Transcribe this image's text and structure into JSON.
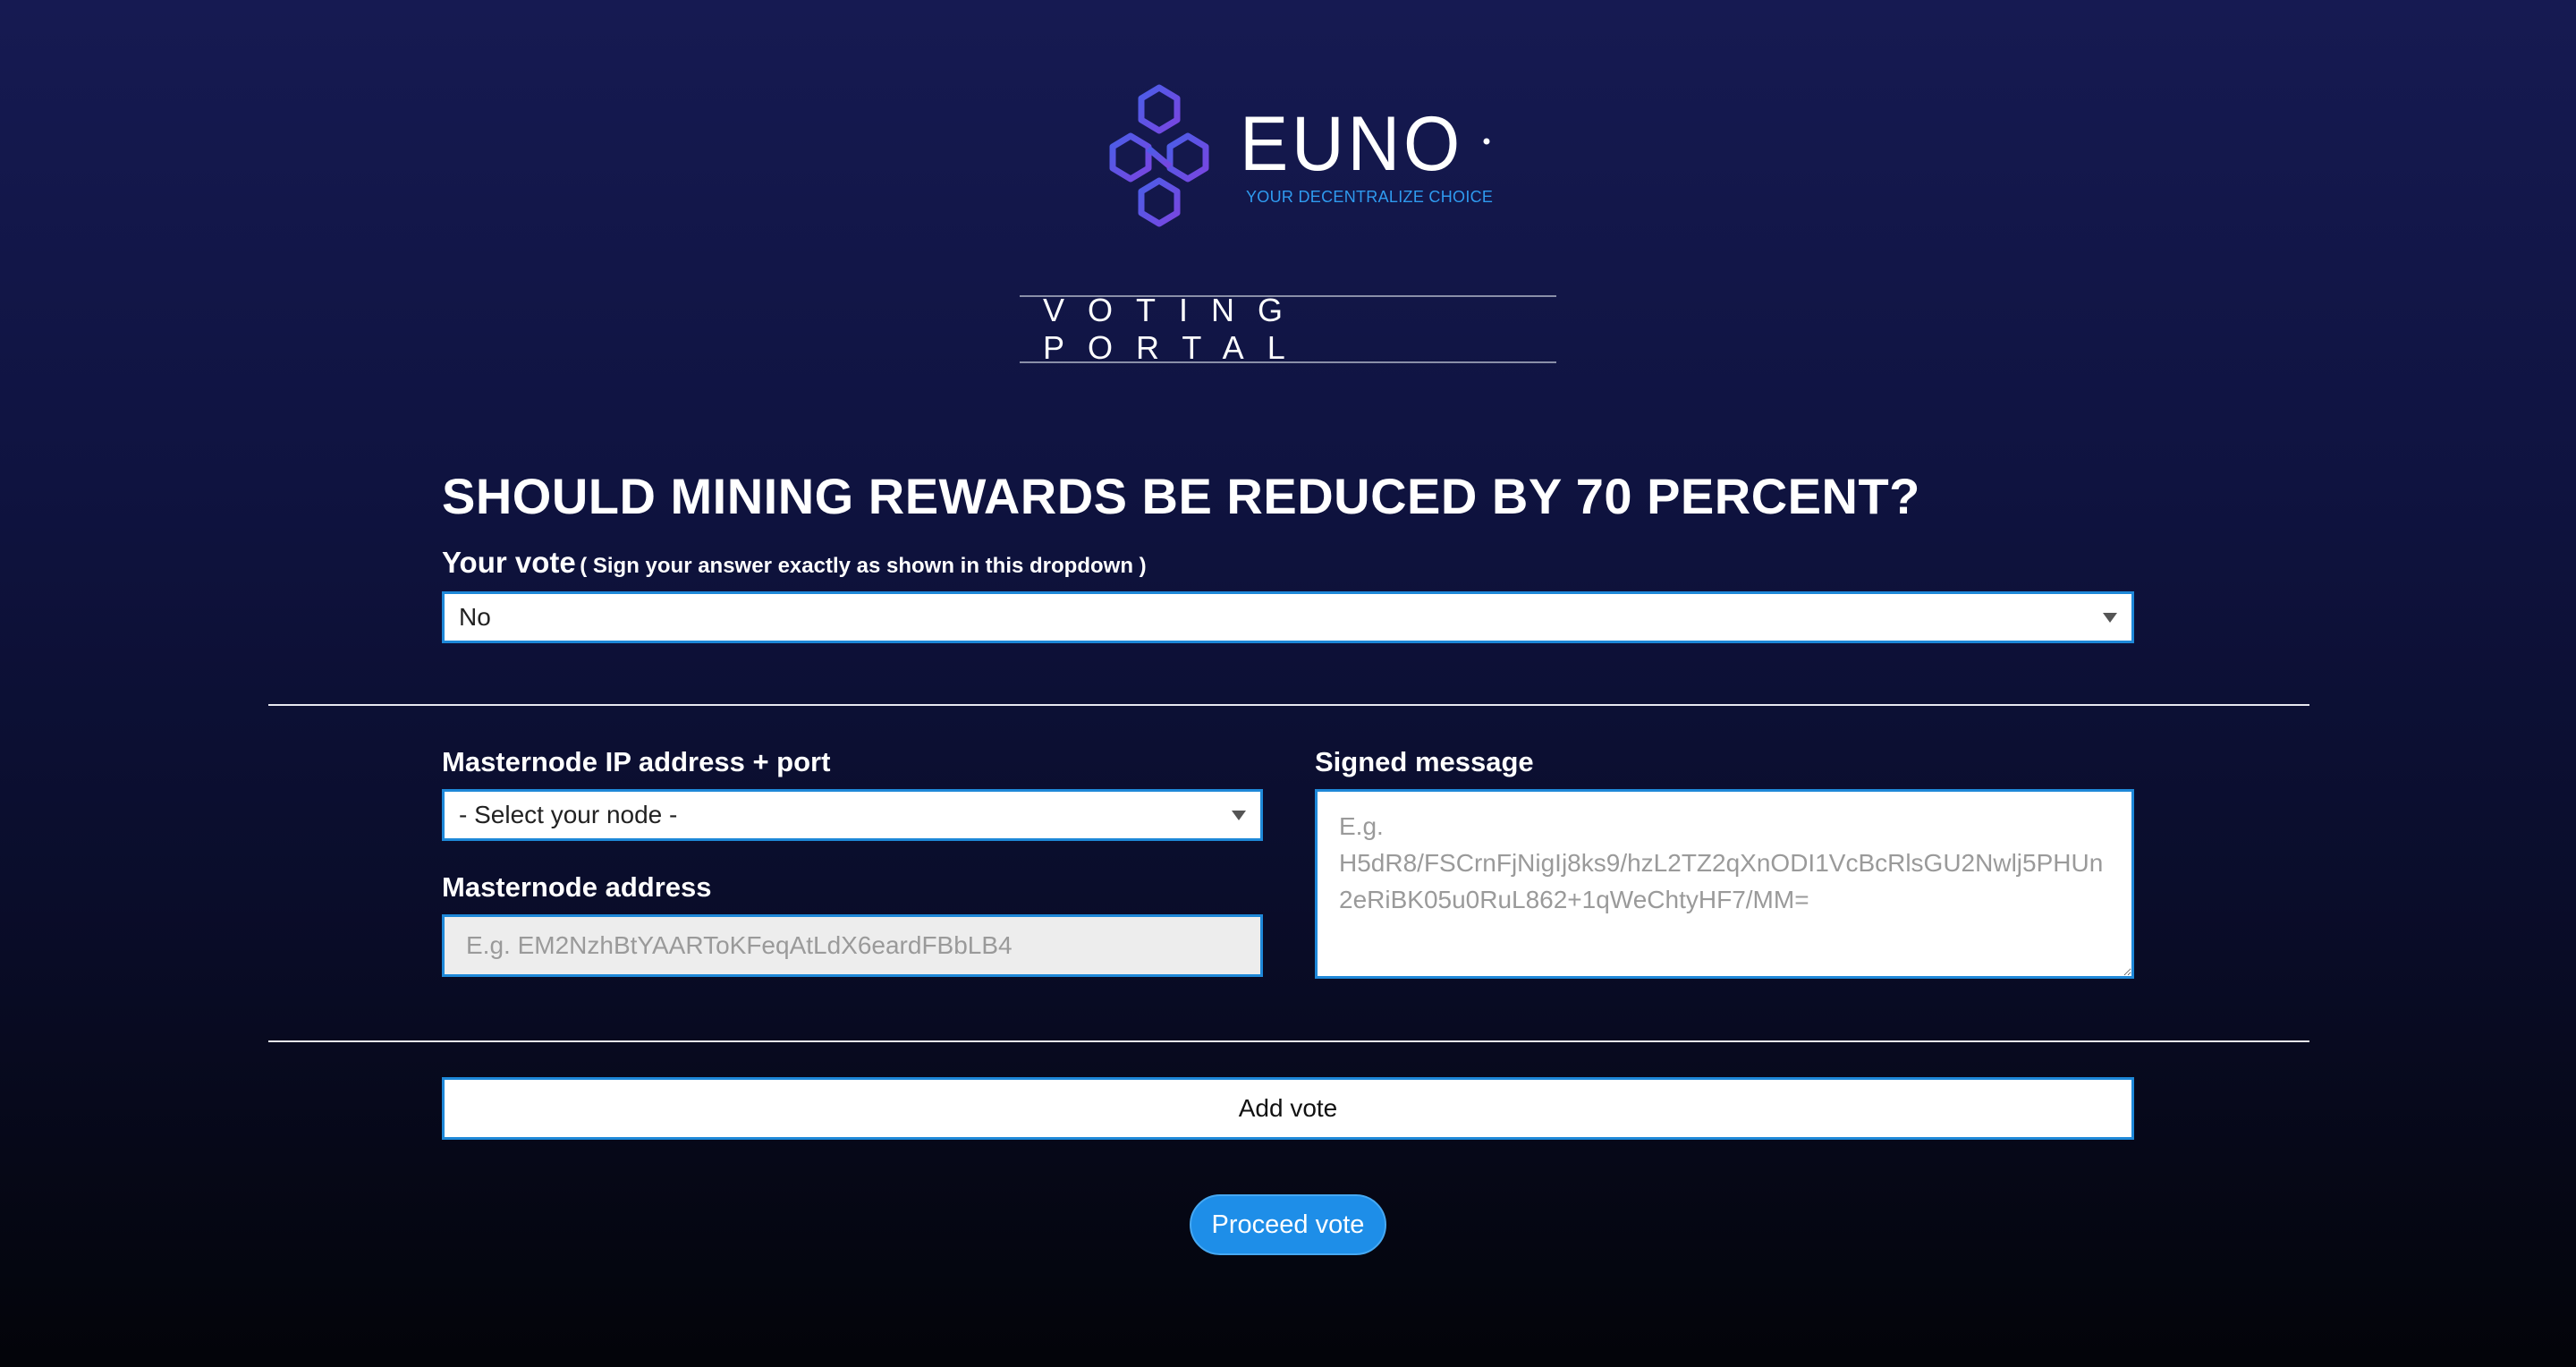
{
  "logo": {
    "wordmark": "EUNO",
    "tagline": "YOUR DECENTRALIZE CHOICE",
    "mark_icon": "euno-hexagon-logo-icon",
    "colors": {
      "mark": "#5b55e0",
      "wordmark": "#ffffff",
      "tagline": "#2f9bf0"
    }
  },
  "portal": {
    "title": "VOTING PORTAL"
  },
  "poll": {
    "question": "SHOULD MINING REWARDS BE REDUCED BY 70 PERCENT?",
    "vote_label": "Your vote",
    "vote_hint": "( Sign your answer exactly as shown in this dropdown )",
    "vote_selected": "No"
  },
  "form": {
    "ip_label": "Masternode IP address + port",
    "node_selected": "- Select your node -",
    "address_label": "Masternode address",
    "address_placeholder": "E.g. EM2NzhBtYAARToKFeqAtLdX6eardFBbLB4",
    "signed_label": "Signed message",
    "signed_placeholder": "E.g.\nH5dR8/FSCrnFjNigIj8ks9/hzL2TZ2qXnODI1VcBcRlsGU2Nwlj5PHUn2eRiBK05u0RuL862+1qWeChtyHF7/MM="
  },
  "actions": {
    "add_vote": "Add vote",
    "proceed_vote": "Proceed vote"
  },
  "theme": {
    "accent": "#1e88d8",
    "button_primary": "#1e8ee8",
    "background_top": "#161a52",
    "background_bottom": "#030409"
  }
}
